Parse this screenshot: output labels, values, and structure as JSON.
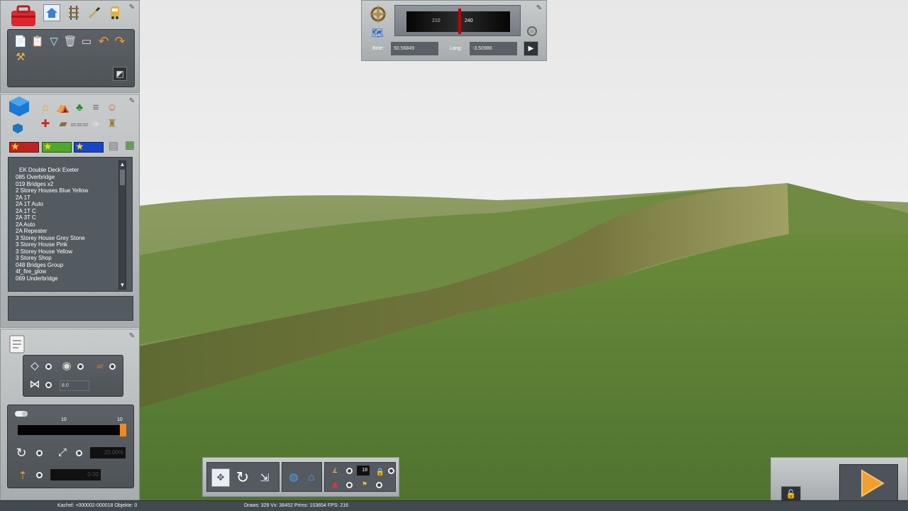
{
  "compass_panel": {
    "dial_ticks": [
      "210",
      "240"
    ],
    "lat_label": "Brite:",
    "lat_value": "50.56849",
    "lon_label": "Lang:",
    "lon_value": "-3.50986"
  },
  "asset_list": {
    "items": [
      "EK Double Deck Exeter",
      "085 Overbridge",
      "019 Bridges x2",
      "2 Storey Houses Blue Yellow",
      "2A 1T",
      "2A 1T Auto",
      "2A 1T C",
      "2A 3T C",
      "2A Auto",
      "2A Repeater",
      "3 Storey House Grey Stone",
      "3 Storey House Pink",
      "3 Storey House Yellow",
      "3 Storey Shop",
      "048 Bridges Group",
      "4f_fire_glow",
      "069 Underbridge"
    ]
  },
  "terrain_panel": {
    "width_value": "8.0",
    "slider_left": "10",
    "slider_right": "10",
    "slider_level": 1.0,
    "percent_value": "20.00%",
    "height_value": "0.00"
  },
  "bottom_toolbar": {
    "counter_value": "18"
  },
  "status_bar": {
    "tile_text": "Kachel: +000002-000018  Objekte: 0",
    "stats_text": "Draws: 329 Vx: 38452 Prims: 103654 FPS: 216"
  },
  "colors": {
    "panel_bg": "#b9bdbf",
    "inner_bg": "#545a5f",
    "accent_orange": "#f08a1c",
    "status_bg": "#424a50"
  }
}
